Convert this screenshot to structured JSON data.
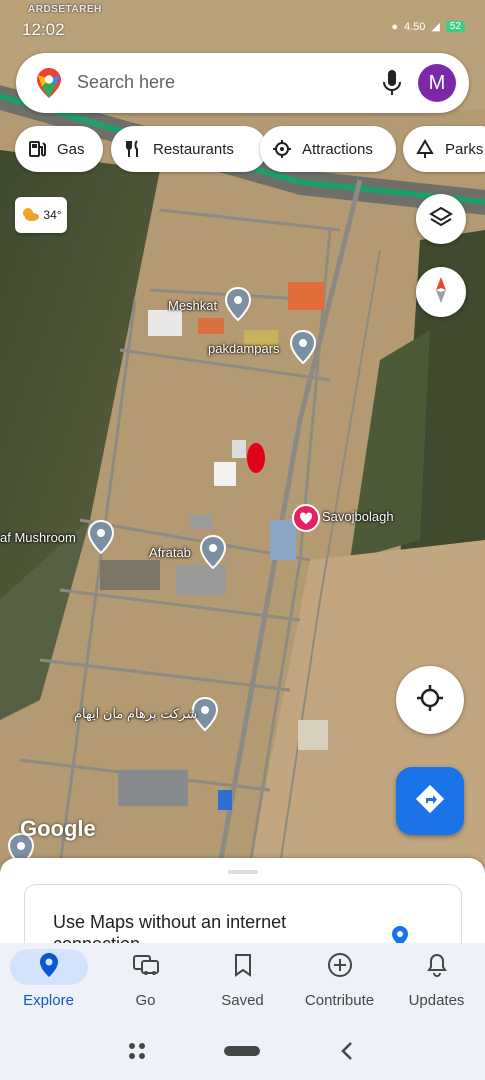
{
  "status_bar": {
    "time": "12:02",
    "area_label": "ARDSETAREH",
    "network_speed": "4.50",
    "battery": "52"
  },
  "search": {
    "placeholder": "Search here",
    "avatar_letter": "M"
  },
  "chips": [
    {
      "label": "Gas",
      "icon": "gas-station-icon"
    },
    {
      "label": "Restaurants",
      "icon": "fork-knife-icon"
    },
    {
      "label": "Attractions",
      "icon": "attractions-icon"
    },
    {
      "label": "Parks",
      "icon": "tree-icon"
    }
  ],
  "weather": {
    "temp": "34°",
    "icon": "partly-sunny-icon"
  },
  "map_labels": {
    "meshkat": "Meshkat",
    "pakdampars": "pakdampars",
    "savojbolagh": "Savojbolagh",
    "mushroom": "af Mushroom",
    "afratab": "Afratab",
    "company": "شرکت پرهام مان ایهام"
  },
  "google_logo": "Google",
  "bottom_sheet": {
    "title": "Use Maps without an internet connection"
  },
  "nav": [
    {
      "label": "Explore",
      "icon": "explore-pin-icon",
      "active": true
    },
    {
      "label": "Go",
      "icon": "car-icon",
      "active": false
    },
    {
      "label": "Saved",
      "icon": "bookmark-icon",
      "active": false
    },
    {
      "label": "Contribute",
      "icon": "add-circle-icon",
      "active": false
    },
    {
      "label": "Updates",
      "icon": "bell-icon",
      "active": false
    }
  ],
  "colors": {
    "accent": "#1a73e8",
    "avatar": "#7b29a8",
    "heart": "#e91e63",
    "active_nav_bg": "#d4e3fc"
  }
}
